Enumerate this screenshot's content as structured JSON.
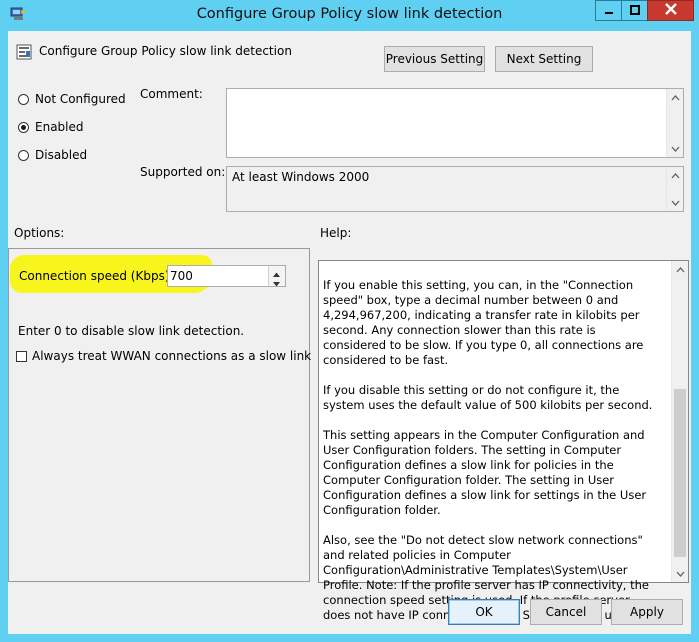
{
  "window": {
    "title": "Configure Group Policy slow link detection"
  },
  "header": {
    "setting_name": "Configure Group Policy slow link detection",
    "previous_label": "Previous Setting",
    "next_label": "Next Setting"
  },
  "state": {
    "options": [
      {
        "label": "Not Configured",
        "checked": false
      },
      {
        "label": "Enabled",
        "checked": true
      },
      {
        "label": "Disabled",
        "checked": false
      }
    ]
  },
  "comment": {
    "label": "Comment:",
    "value": ""
  },
  "supported": {
    "label": "Supported on:",
    "value": "At least Windows 2000"
  },
  "options_section": {
    "label": "Options:",
    "connection_speed_label": "Connection speed (Kbps):",
    "connection_speed_value": "700",
    "hint": "Enter 0 to disable slow link detection.",
    "wwan_label": "Always treat WWAN connections as a slow link"
  },
  "help_section": {
    "label": "Help:",
    "paragraphs": [
      "If you enable this setting, you can, in the \"Connection speed\" box, type a decimal number between 0 and 4,294,967,200, indicating a transfer rate in kilobits per second. Any connection slower than this rate is considered to be slow. If you type 0, all connections are considered to be fast.",
      "If you disable this setting or do not configure it, the system uses the default value of 500 kilobits per second.",
      "This setting appears in the Computer Configuration and User Configuration folders. The setting in Computer Configuration defines a slow link for policies in the Computer Configuration folder. The setting in User Configuration defines a slow link for settings in the User Configuration folder.",
      "Also, see the \"Do not detect slow network connections\" and related policies in Computer Configuration\\Administrative Templates\\System\\User Profile. Note: If the profile server has IP connectivity, the connection speed setting is used. If the profile server does not have IP connectivity, the SMB timing is used."
    ]
  },
  "footer": {
    "ok_label": "OK",
    "cancel_label": "Cancel",
    "apply_label": "Apply"
  },
  "colors": {
    "title_bar": "#5fcff2",
    "close_button": "#c7392f",
    "highlight": "#f7f51c"
  },
  "icons": [
    "policy-window-icon",
    "minimize-icon",
    "maximize-icon",
    "close-icon",
    "policy-setting-icon",
    "scroll-up-icon",
    "scroll-down-icon",
    "spin-up-icon",
    "spin-down-icon"
  ]
}
